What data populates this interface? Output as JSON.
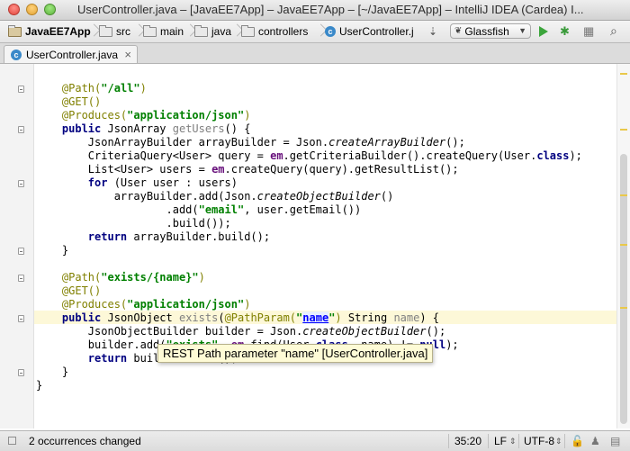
{
  "window": {
    "title": "UserController.java – [JavaEE7App] – JavaEE7App – [~/JavaEE7App] – IntelliJ IDEA (Cardea) I..."
  },
  "navbar": {
    "breadcrumbs": [
      "JavaEE7App",
      "src",
      "main",
      "java",
      "controllers",
      "UserController.j"
    ],
    "run_config": "Glassfish"
  },
  "tabs": [
    {
      "label": "UserController.java",
      "close": "×"
    }
  ],
  "editor": {
    "tooltip": "REST Path parameter \"name\" [UserController.java]"
  },
  "statusbar": {
    "message": "2 occurrences changed",
    "position": "35:20",
    "line_separator": "LF",
    "encoding": "UTF-8"
  },
  "colors": {
    "keyword": "#000080",
    "annotation": "#808000",
    "string": "#008000",
    "field": "#660e7a",
    "caret_line": "#fdf8d8",
    "tooltip_bg": "#fefbd6"
  }
}
